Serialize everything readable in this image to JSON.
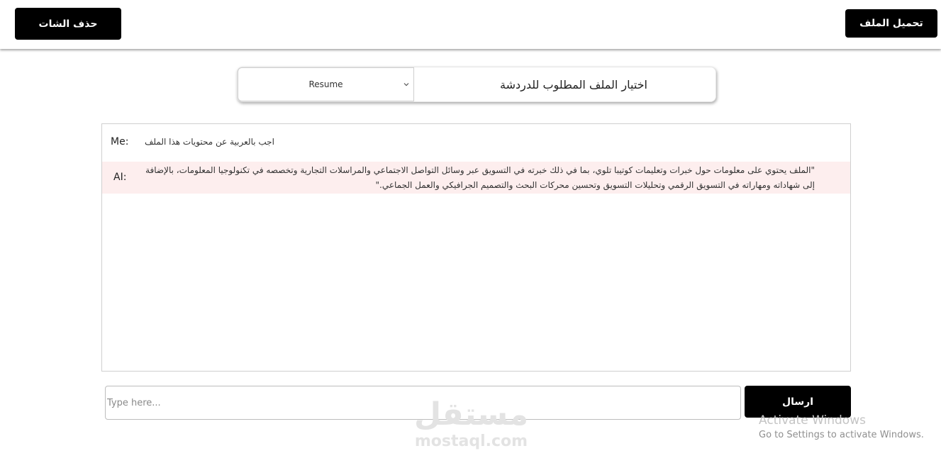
{
  "header": {
    "clear_chat_label": "حذف الشات",
    "upload_file_label": "تحميل الملف"
  },
  "file_selector": {
    "title": "اختيار الملف المطلوب للدردشة",
    "selected": "Resume"
  },
  "chat": {
    "messages": [
      {
        "sender": "Me:",
        "text": "اجب بالعربية  عن محتويات هذا الملف"
      },
      {
        "sender": "AI:",
        "text": "\"الملف يحتوي على معلومات حول خبرات وتعليمات كوتيبا تلوي، بما في ذلك خبرته في التسويق عبر وسائل التواصل الاجتماعي والمراسلات التجارية وتخصصه في تكنولوجيا المعلومات، بالإضافة إلى شهاداته ومهاراته في التسويق الرقمي وتحليلات التسويق وتحسين محركات البحث والتصميم الجرافيكي والعمل الجماعي.\""
      }
    ]
  },
  "composer": {
    "placeholder": "Type here...",
    "send_label": "ارسال"
  },
  "watermarks": {
    "mostaql_ar": "مستقل",
    "mostaql_en": "mostaql.com",
    "windows_title": "Activate Windows",
    "windows_sub": "Go to Settings to activate Windows."
  }
}
